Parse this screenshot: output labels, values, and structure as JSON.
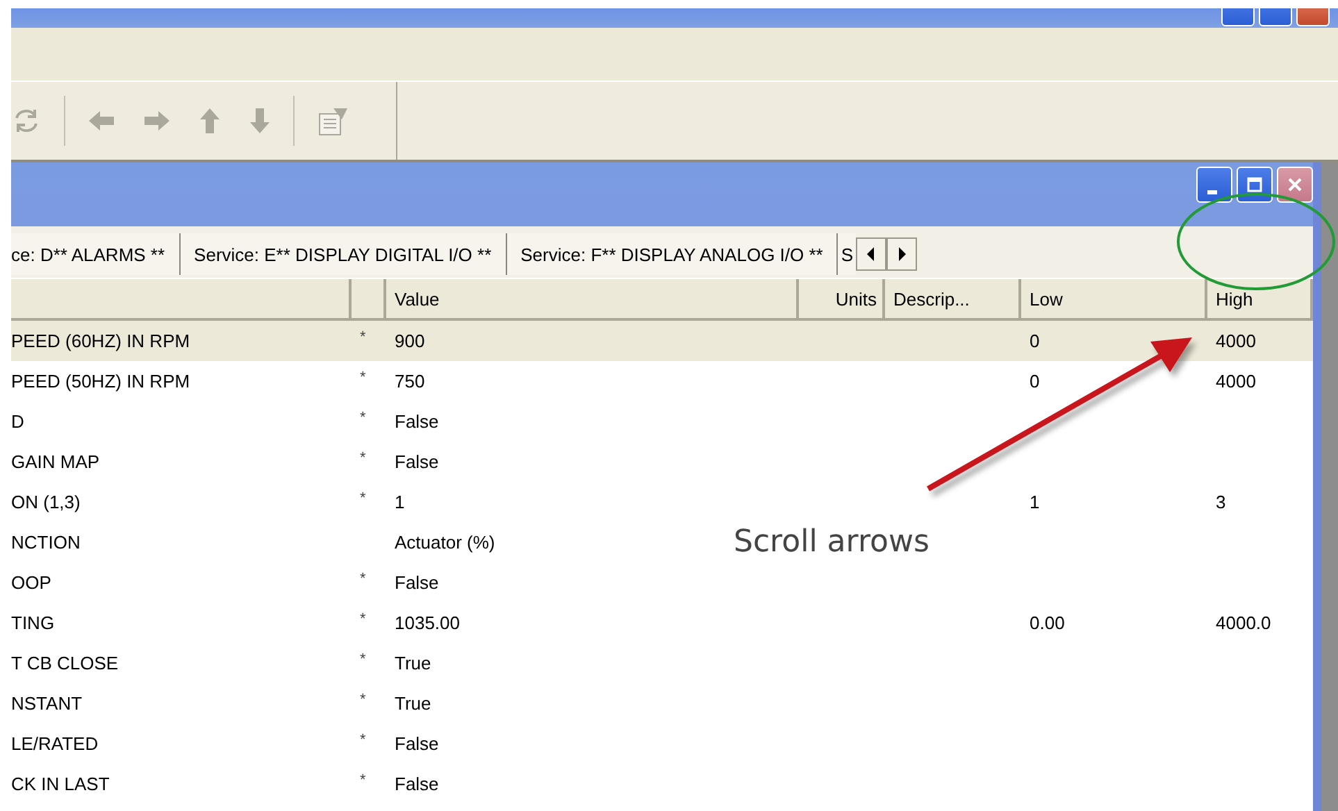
{
  "toolbar": {
    "buttons": [
      {
        "kind": "refresh",
        "disabled": true
      },
      {
        "kind": "separator"
      },
      {
        "kind": "back",
        "disabled": true
      },
      {
        "kind": "forward",
        "disabled": true
      },
      {
        "kind": "up",
        "disabled": true
      },
      {
        "kind": "down",
        "disabled": true
      },
      {
        "kind": "separator"
      },
      {
        "kind": "properties",
        "disabled": true
      }
    ]
  },
  "tabs": [
    {
      "label": "ce: D** ALARMS **",
      "selected": false
    },
    {
      "label": "Service: E** DISPLAY DIGITAL I/O **",
      "selected": false
    },
    {
      "label": "Service: F** DISPLAY ANALOG I/O **",
      "selected": false
    },
    {
      "label": "S",
      "selected": false
    }
  ],
  "table": {
    "columns": [
      {
        "label": "Value"
      },
      {
        "label": "Units"
      },
      {
        "label": "Descrip..."
      },
      {
        "label": "Low"
      },
      {
        "label": "High"
      }
    ],
    "rows": [
      {
        "name": "PEED (60HZ) IN RPM",
        "flag": "*",
        "value": "900",
        "low": "0",
        "high": "4000",
        "selected": true
      },
      {
        "name": "PEED (50HZ)  IN RPM",
        "flag": "*",
        "value": "750",
        "low": "0",
        "high": "4000",
        "selected": false
      },
      {
        "name": "D",
        "flag": "*",
        "value": "False",
        "selected": false
      },
      {
        "name": "GAIN MAP",
        "flag": "*",
        "value": "False",
        "selected": false
      },
      {
        "name": "ON (1,3)",
        "flag": "*",
        "value": "1",
        "low": "1",
        "high": "3",
        "selected": false
      },
      {
        "name": "NCTION",
        "value": "Actuator (%)",
        "selected": false
      },
      {
        "name": "OOP",
        "flag": "*",
        "value": "False",
        "selected": false
      },
      {
        "name": "TING",
        "flag": "*",
        "value": "1035.00",
        "low": "0.00",
        "high": "4000.0",
        "selected": false
      },
      {
        "name": "T CB CLOSE",
        "flag": "*",
        "value": "True",
        "selected": false
      },
      {
        "name": "NSTANT",
        "flag": "*",
        "value": "True",
        "selected": false
      },
      {
        "name": "LE/RATED",
        "flag": "*",
        "value": "False",
        "selected": false
      },
      {
        "name": "CK IN LAST",
        "flag": "*",
        "value": "False",
        "selected": false
      }
    ]
  },
  "annotation": {
    "label": "Scroll arrows"
  }
}
